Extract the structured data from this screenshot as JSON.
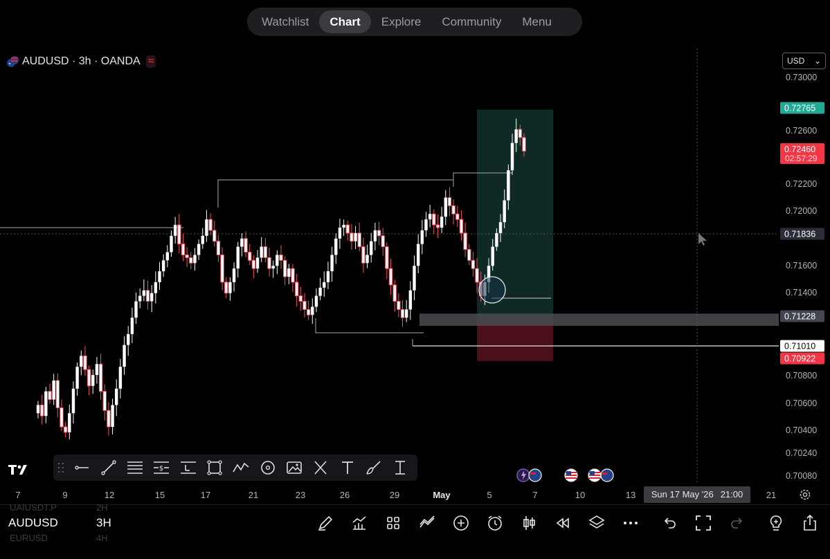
{
  "nav": {
    "tabs": [
      {
        "label": "Watchlist",
        "active": false
      },
      {
        "label": "Chart",
        "active": true
      },
      {
        "label": "Explore",
        "active": false
      },
      {
        "label": "Community",
        "active": false
      },
      {
        "label": "Menu",
        "active": false
      }
    ]
  },
  "header": {
    "symbol_text": "AUDUSD · 3h · OANDA",
    "wave_glyph": "≈",
    "currency": "USD",
    "currency_caret": "⌄"
  },
  "chart_data": {
    "type": "candlestick",
    "symbol": "AUDUSD",
    "interval": "3h",
    "exchange": "OANDA",
    "y_ticks": [
      "0.73000",
      "0.72800",
      "0.72600",
      "0.72400",
      "0.72200",
      "0.72000",
      "0.71800",
      "0.71600",
      "0.71400",
      "0.71200",
      "0.71000",
      "0.70800",
      "0.70600",
      "0.70400",
      "0.70240",
      "0.70080"
    ],
    "y_labels_printed": [
      "0.73000",
      "0.72600",
      "0.72200",
      "0.72000",
      "0.71600",
      "0.71400",
      "0.70800",
      "0.70600",
      "0.70400",
      "0.70240",
      "0.70080"
    ],
    "ylim": [
      0.7006,
      0.7312
    ],
    "x_ticks": [
      "7",
      "9",
      "12",
      "15",
      "17",
      "21",
      "23",
      "26",
      "29",
      "May",
      "5",
      "7",
      "10",
      "13",
      "21"
    ],
    "price_badges": [
      {
        "value": "0.72765",
        "color": "#22ab94",
        "meaning": "target"
      },
      {
        "value": "0.72460",
        "color": "#f23645",
        "meaning": "last price",
        "countdown": "02:57:29"
      },
      {
        "value": "0.71836",
        "color": "#2a2e39",
        "meaning": "crosshair"
      },
      {
        "value": "0.71228",
        "color": "#434651",
        "meaning": "zone"
      },
      {
        "value": "0.71010",
        "color": "#ffffff",
        "meaning": "line"
      },
      {
        "value": "0.70922",
        "color": "#f23645",
        "meaning": "stop"
      }
    ],
    "long_position": {
      "entry": 0.71228,
      "target": 0.72765,
      "stop": 0.70922
    },
    "horizontal_zone": [
      0.7118,
      0.7127
    ],
    "candle_close_path": [
      0.706,
      0.7052,
      0.707,
      0.7064,
      0.7078,
      0.7058,
      0.7044,
      0.704,
      0.7054,
      0.7072,
      0.7088,
      0.7096,
      0.7086,
      0.7074,
      0.7082,
      0.709,
      0.707,
      0.7056,
      0.7044,
      0.706,
      0.7072,
      0.7088,
      0.7104,
      0.7112,
      0.7124,
      0.7136,
      0.714,
      0.7144,
      0.7136,
      0.7142,
      0.715,
      0.7158,
      0.7166,
      0.7172,
      0.7184,
      0.7192,
      0.7178,
      0.717,
      0.7168,
      0.7164,
      0.717,
      0.7178,
      0.7184,
      0.7196,
      0.7188,
      0.718,
      0.717,
      0.715,
      0.7142,
      0.715,
      0.716,
      0.7176,
      0.7182,
      0.7172,
      0.7166,
      0.716,
      0.7168,
      0.7176,
      0.7168,
      0.716,
      0.7162,
      0.717,
      0.7166,
      0.7154,
      0.716,
      0.715,
      0.714,
      0.7136,
      0.713,
      0.7126,
      0.7132,
      0.714,
      0.7146,
      0.715,
      0.7158,
      0.717,
      0.7182,
      0.719,
      0.7192,
      0.7186,
      0.718,
      0.7186,
      0.7176,
      0.7164,
      0.717,
      0.718,
      0.7188,
      0.7184,
      0.7176,
      0.716,
      0.7148,
      0.7136,
      0.713,
      0.7124,
      0.713,
      0.7144,
      0.7162,
      0.7178,
      0.7188,
      0.7196,
      0.72,
      0.7192,
      0.719,
      0.7198,
      0.7212,
      0.7206,
      0.72,
      0.7196,
      0.7186,
      0.7174,
      0.7166,
      0.716,
      0.715,
      0.714,
      0.715,
      0.7162,
      0.7176,
      0.7186,
      0.7194,
      0.721,
      0.7232,
      0.7252,
      0.7262,
      0.7256,
      0.7246
    ]
  },
  "time_tooltip": {
    "date": "Sun 17 May '26",
    "time": "21:00"
  },
  "bottom": {
    "symbol": "AUDUSD",
    "interval": "3H",
    "ghost_above_symbol": "UAIUSDT.P",
    "ghost_above_interval": "2H",
    "ghost_below_symbol": "EURUSD",
    "ghost_below_interval": "4H"
  },
  "colors": {
    "up": "#ffffff",
    "down": "#f7525f",
    "target_zone": "#0f2a24",
    "stop_zone": "#4a0f18",
    "background": "#000000"
  }
}
